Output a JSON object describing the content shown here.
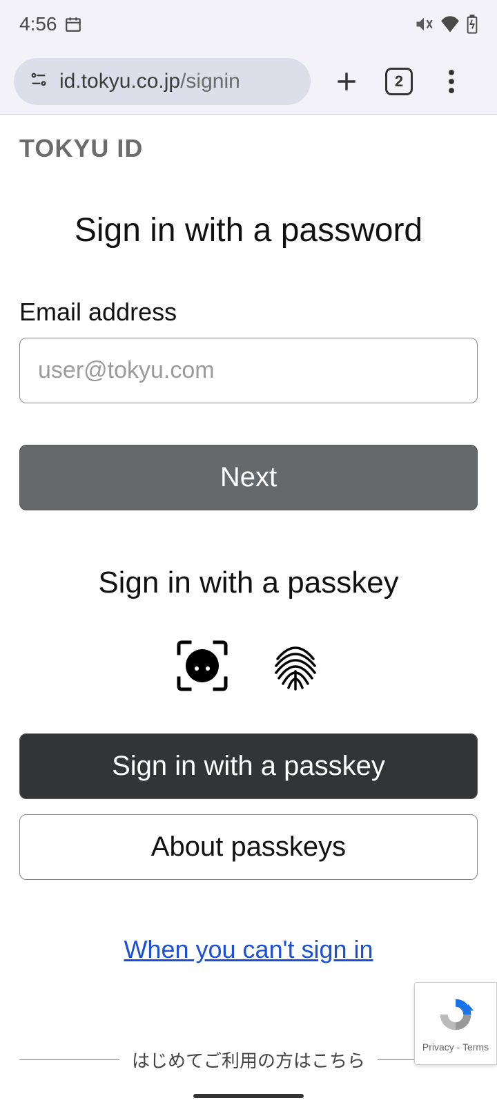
{
  "status": {
    "time": "4:56"
  },
  "browser": {
    "url_host": "id.tokyu.co.jp",
    "url_path": "/signin",
    "tab_count": "2"
  },
  "page": {
    "brand": "TOKYU ID",
    "heading_password": "Sign in with a password",
    "email_label": "Email address",
    "email_placeholder": "user@tokyu.com",
    "next_button": "Next",
    "heading_passkey": "Sign in with a passkey",
    "passkey_button": "Sign in with a passkey",
    "about_passkeys": "About passkeys",
    "cant_signin_link": "When you can't sign in",
    "first_time_text": "はじめてご利用の方はこちら"
  },
  "recaptcha": {
    "links": "Privacy - Terms"
  }
}
